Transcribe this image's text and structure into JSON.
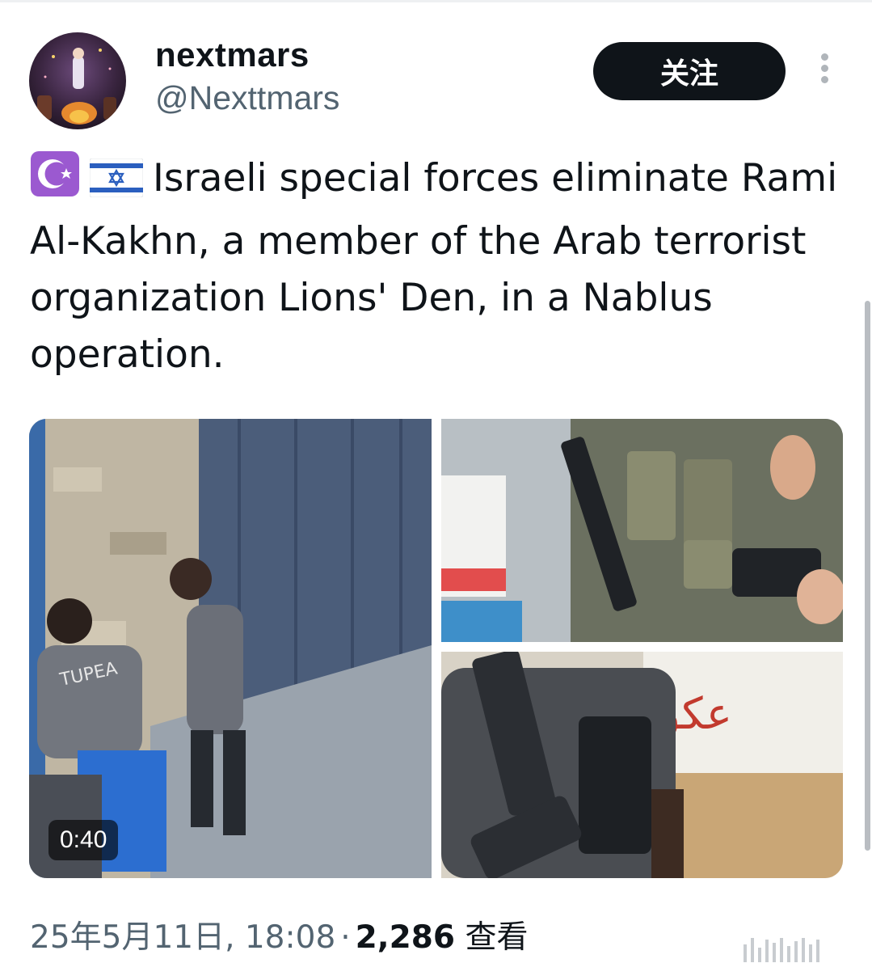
{
  "author": {
    "display_name": "nextmars",
    "handle": "@Nexttmars"
  },
  "follow_button": {
    "label": "关注"
  },
  "tweet": {
    "emojis": [
      "crescent-star-emoji",
      "israel-flag-emoji"
    ],
    "text": "Israeli special forces eliminate Rami Al-Kakhn, a member of the Arab terrorist organization Lions' Den, in a Nablus operation."
  },
  "media": {
    "video_duration": "0:40"
  },
  "meta": {
    "date": "25年5月11日, 18:08",
    "separator": "·",
    "views_count": "2,286",
    "views_label": "查看"
  }
}
